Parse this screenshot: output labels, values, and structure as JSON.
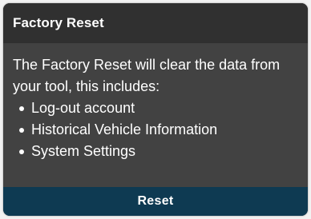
{
  "dialog": {
    "title": "Factory Reset",
    "message": "The Factory Reset will clear the data from your tool, this includes:",
    "items": [
      {
        "label": "Log-out account"
      },
      {
        "label": "Historical Vehicle Information"
      },
      {
        "label": "System Settings"
      }
    ],
    "reset_label": "Reset"
  },
  "colors": {
    "header_bg": "#303030",
    "body_bg": "#424242",
    "button_bg": "#0e3a52",
    "text": "#ffffff"
  }
}
